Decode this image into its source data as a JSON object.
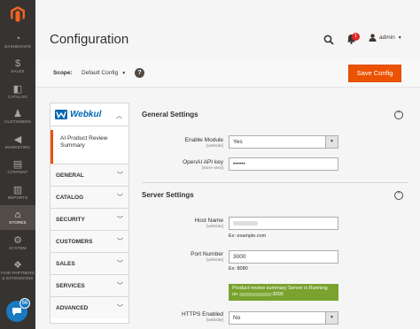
{
  "menu": {
    "items": [
      {
        "label": "Dashboard",
        "icon": "dashboard-icon",
        "glyph": "◔"
      },
      {
        "label": "Sales",
        "icon": "dollar-icon",
        "glyph": "$"
      },
      {
        "label": "Catalog",
        "icon": "box-icon",
        "glyph": "◧"
      },
      {
        "label": "Customers",
        "icon": "person-icon",
        "glyph": "♟"
      },
      {
        "label": "Marketing",
        "icon": "megaphone-icon",
        "glyph": "◀"
      },
      {
        "label": "Content",
        "icon": "content-icon",
        "glyph": "▤"
      },
      {
        "label": "Reports",
        "icon": "bar-chart-icon",
        "glyph": "▥"
      },
      {
        "label": "Stores",
        "icon": "store-icon",
        "glyph": "⌂"
      },
      {
        "label": "System",
        "icon": "gear-icon",
        "glyph": "⚙"
      },
      {
        "label": "Find Partners & Extensions",
        "icon": "cubes-icon",
        "glyph": "❖"
      }
    ],
    "chat_badge": "66"
  },
  "header": {
    "title": "Configuration",
    "notifications_count": "1",
    "user": "admin"
  },
  "scope": {
    "label": "Scope:",
    "value": "Default Config",
    "help": "?",
    "save_label": "Save Config"
  },
  "tabs": {
    "brand": "Webkul",
    "active_item": "AI Product Review Summary",
    "groups": [
      "GENERAL",
      "CATALOG",
      "SECURITY",
      "CUSTOMERS",
      "SALES",
      "SERVICES",
      "ADVANCED"
    ]
  },
  "general_settings": {
    "title": "General Settings",
    "enable_module": {
      "label": "Enable Module",
      "scope": "[website]",
      "value": "Yes"
    },
    "api_key": {
      "label": "OpenAI API key",
      "scope": "[store view]",
      "value": "••••••"
    }
  },
  "server_settings": {
    "title": "Server Settings",
    "host_name": {
      "label": "Host Name",
      "scope": "[website]",
      "note": "Ex: example.com"
    },
    "port_number": {
      "label": "Port Number",
      "scope": "[website]",
      "value": "3000",
      "note": "Ex: 8080"
    },
    "status": {
      "line1": "Product review summary Server is Running",
      "line2_prefix": "on",
      "line2_suffix": ":3000"
    },
    "https_enabled": {
      "label": "HTTPS Enabled",
      "scope": "[website]",
      "value": "No"
    }
  },
  "colors": {
    "sidebar": "#373330",
    "accent": "#eb5202",
    "brand": "#0066b3",
    "status_ok": "#79a22e"
  }
}
